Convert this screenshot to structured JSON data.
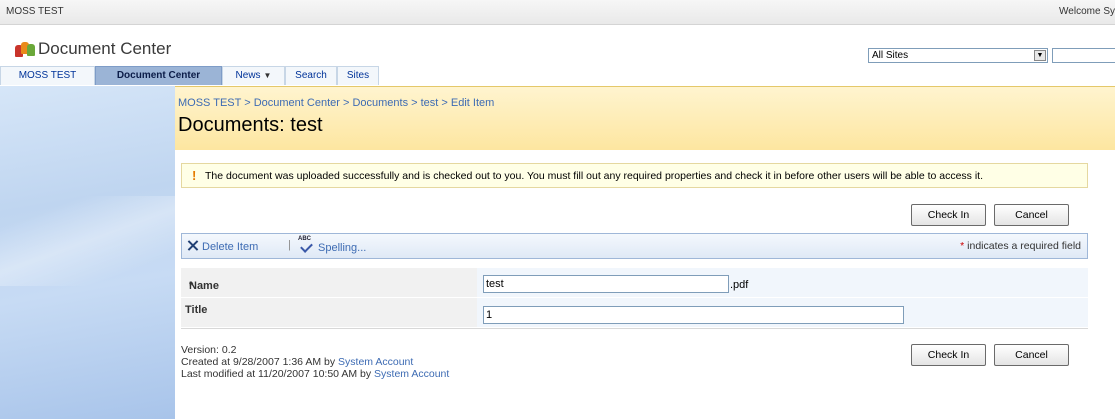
{
  "topbar": {
    "site_name": "MOSS TEST",
    "welcome": "Welcome Sy"
  },
  "header": {
    "title": "Document Center",
    "search_scope": "All Sites",
    "search_placeholder": ""
  },
  "tabs": [
    {
      "label": "MOSS TEST",
      "selected": false
    },
    {
      "label": "Document Center",
      "selected": true
    },
    {
      "label": "News",
      "selected": false,
      "has_dropdown": true
    },
    {
      "label": "Search",
      "selected": false
    },
    {
      "label": "Sites",
      "selected": false
    }
  ],
  "page": {
    "breadcrumb": "MOSS TEST > Document Center > Documents > test > Edit Item",
    "title": "Documents: test"
  },
  "message": "The document was uploaded successfully and is checked out to you. You must fill out any required properties and check it in before other users will be able to access it.",
  "buttons": {
    "check_in": "Check In",
    "cancel": "Cancel"
  },
  "toolbar": {
    "delete_item": "Delete Item",
    "spelling": "Spelling...",
    "required_note": "indicates a required field",
    "required_star": "*"
  },
  "form": {
    "name_label": "Name",
    "name_value": "test",
    "name_ext": ".pdf",
    "title_label": "Title",
    "title_value": "1"
  },
  "meta": {
    "version": "Version: 0.2",
    "created": "Created at 9/28/2007 1:36 AM  by",
    "created_by": "System Account",
    "modified": "Last modified at 11/20/2007 10:50 AM  by",
    "modified_by": "System Account"
  },
  "colors": {
    "accent": "#3d6bb3",
    "title_bar": "#fde6a0",
    "tab_selected": "#9bb4d6",
    "required": "#cc0000"
  }
}
